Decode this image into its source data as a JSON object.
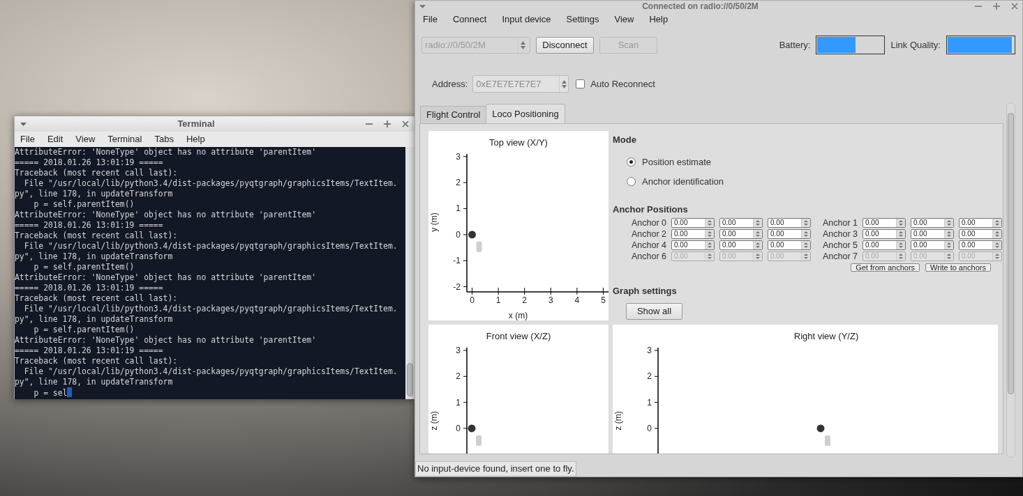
{
  "terminal": {
    "title": "Terminal",
    "menu": [
      "File",
      "Edit",
      "View",
      "Terminal",
      "Tabs",
      "Help"
    ],
    "lines": [
      "AttributeError: 'NoneType' object has no attribute 'parentItem'",
      "===== 2018.01.26 13:01:19 =====",
      "Traceback (most recent call last):",
      "  File \"/usr/local/lib/python3.4/dist-packages/pyqtgraph/graphicsItems/TextItem.",
      "py\", line 178, in updateTransform",
      "    p = self.parentItem()",
      "AttributeError: 'NoneType' object has no attribute 'parentItem'",
      "===== 2018.01.26 13:01:19 =====",
      "Traceback (most recent call last):",
      "  File \"/usr/local/lib/python3.4/dist-packages/pyqtgraph/graphicsItems/TextItem.",
      "py\", line 178, in updateTransform",
      "    p = self.parentItem()",
      "AttributeError: 'NoneType' object has no attribute 'parentItem'",
      "===== 2018.01.26 13:01:19 =====",
      "Traceback (most recent call last):",
      "  File \"/usr/local/lib/python3.4/dist-packages/pyqtgraph/graphicsItems/TextItem.",
      "py\", line 178, in updateTransform",
      "    p = self.parentItem()",
      "AttributeError: 'NoneType' object has no attribute 'parentItem'",
      "===== 2018.01.26 13:01:19 =====",
      "Traceback (most recent call last):",
      "  File \"/usr/local/lib/python3.4/dist-packages/pyqtgraph/graphicsItems/TextItem.",
      "py\", line 178, in updateTransform",
      "    p = sel"
    ],
    "cursor_visible": true
  },
  "main_window": {
    "title": "Connected on radio://0/50/2M",
    "menu": [
      "File",
      "Connect",
      "Input device",
      "Settings",
      "View",
      "Help"
    ],
    "interface": {
      "value": "radio://0/50/2M",
      "disabled": true
    },
    "buttons": [
      {
        "label": "Disconnect",
        "disabled": false
      },
      {
        "label": "Scan",
        "disabled": true
      }
    ],
    "battery": {
      "label": "Battery:",
      "level": 0.57
    },
    "link_quality": {
      "label": "Link Quality:",
      "level": 0.97
    },
    "address": {
      "label": "Address:",
      "value": "0xE7E7E7E7E7",
      "disabled": true
    },
    "auto_reconnect": {
      "label": "Auto Reconnect",
      "checked": false
    },
    "tabs": [
      {
        "label": "Flight Control",
        "selected": false
      },
      {
        "label": "Loco Positioning",
        "selected": true
      }
    ],
    "loco": {
      "plots": [
        {
          "chart_data": {
            "type": "scatter",
            "title": "Top view (X/Y)",
            "xlabel": "x (m)",
            "ylabel": "y (m)",
            "x": [
              0
            ],
            "series": [
              {
                "color": "#333333",
                "values": [
                  0
                ]
              }
            ],
            "xlim": [
              -0.2,
              5.2
            ],
            "ylim": [
              -2.2,
              3.1
            ],
            "xticks": [
              {
                "value": 0,
                "label": "0"
              },
              {
                "value": 1,
                "label": "1"
              },
              {
                "value": 2,
                "label": "2"
              },
              {
                "value": 3,
                "label": "3"
              },
              {
                "value": 4,
                "label": "4"
              },
              {
                "value": 5,
                "label": "5"
              }
            ],
            "yticks": [
              {
                "value": -2,
                "label": "-2"
              },
              {
                "value": -1,
                "label": "-1"
              },
              {
                "value": 0,
                "label": "0"
              },
              {
                "value": 1,
                "label": "1"
              },
              {
                "value": 2,
                "label": "2"
              },
              {
                "value": 3,
                "label": "3"
              }
            ]
          }
        },
        {
          "title": "Front view (X/Z)",
          "ylabel": "z (m)",
          "tick_labels": [
            "3",
            "2",
            "1",
            "0"
          ]
        },
        {
          "title": "Right view (Y/Z)",
          "ylabel": "z (m)",
          "tick_labels": [
            "3",
            "2",
            "1",
            "0"
          ]
        }
      ],
      "mode": {
        "heading": "Mode",
        "options": [
          {
            "label": "Position estimate",
            "selected": true
          },
          {
            "label": "Anchor identification",
            "selected": false
          }
        ]
      },
      "anchor_positions": {
        "heading": "Anchor Positions",
        "anchors": [
          {
            "label": "Anchor 0",
            "values": [
              "0.00",
              "0.00",
              "0.00"
            ],
            "disabled": false
          },
          {
            "label": "Anchor 1",
            "values": [
              "0.00",
              "0.00",
              "0.00"
            ],
            "disabled": false
          },
          {
            "label": "Anchor 2",
            "values": [
              "0.00",
              "0.00",
              "0.00"
            ],
            "disabled": false
          },
          {
            "label": "Anchor 3",
            "values": [
              "0.00",
              "0.00",
              "0.00"
            ],
            "disabled": false
          },
          {
            "label": "Anchor 4",
            "values": [
              "0.00",
              "0.00",
              "0.00"
            ],
            "disabled": false
          },
          {
            "label": "Anchor 5",
            "values": [
              "0.00",
              "0.00",
              "0.00"
            ],
            "disabled": false
          },
          {
            "label": "Anchor 6",
            "values": [
              "0.00",
              "0.00",
              "0.00"
            ],
            "disabled": true
          },
          {
            "label": "Anchor 7",
            "values": [
              "0.00",
              "0.00",
              "0.00"
            ],
            "disabled": true
          }
        ],
        "buttons": [
          "Get from anchors",
          "Write to anchors"
        ]
      },
      "graph_settings": {
        "heading": "Graph settings",
        "button": "Show all"
      }
    },
    "status_bar": "No input-device found, insert one to fly."
  }
}
